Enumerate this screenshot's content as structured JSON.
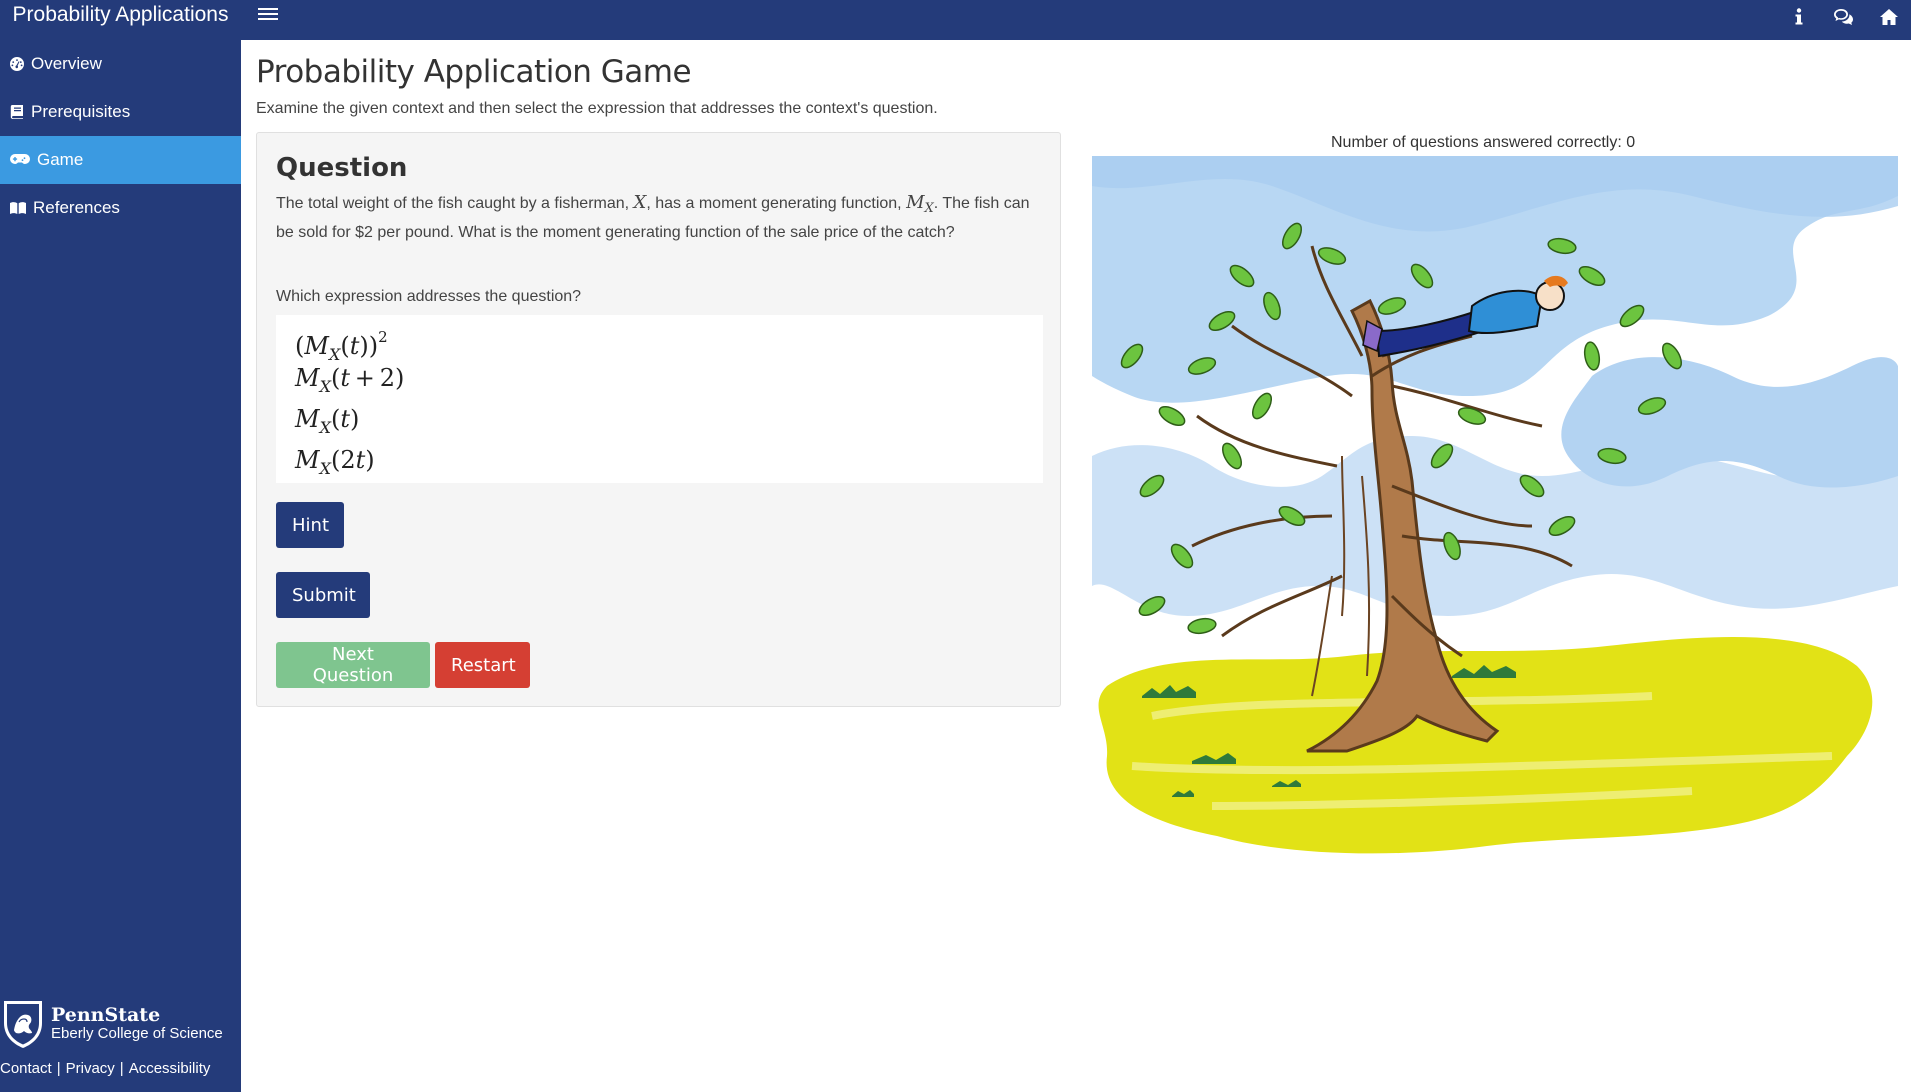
{
  "app": {
    "title": "Probability Applications",
    "menu_icon": "hamburger-icon",
    "header_icons": [
      "info-icon",
      "chat-bubbles-icon",
      "home-icon"
    ]
  },
  "sidebar": {
    "items": [
      {
        "label": "Overview",
        "icon": "dashboard-gauge-icon",
        "active": false
      },
      {
        "label": "Prerequisites",
        "icon": "book-icon",
        "active": false
      },
      {
        "label": "Game",
        "icon": "gamepad-icon",
        "active": true
      },
      {
        "label": "References",
        "icon": "open-book-icon",
        "active": false
      }
    ],
    "footer": {
      "university": "PennState",
      "college": "Eberly College of Science",
      "links": [
        "Contact",
        "Privacy",
        "Accessibility"
      ]
    }
  },
  "main": {
    "title": "Probability Application Game",
    "subtitle": "Examine the given context and then select the expression that addresses the context's question.",
    "score_label": "Number of questions answered correctly: 0",
    "question": {
      "heading": "Question",
      "text_parts": [
        "The total weight of the fish caught by a fisherman, ",
        "X",
        ", has a moment generating function, ",
        "M",
        "X",
        ". The fish can be sold for $2 per pound. What is the moment generating function of the sale price of the catch?"
      ],
      "prompt": "Which expression addresses the question?",
      "choices": [
        "(M_X(t))^2",
        "M_X(t+2)",
        "M_X(t)",
        "M_X(2t)"
      ]
    },
    "buttons": {
      "hint": "Hint",
      "submit": "Submit",
      "next": "Next Question",
      "restart": "Restart"
    },
    "illustration": "man-lying-in-tree-illustration"
  },
  "colors": {
    "header_bg": "#243b7a",
    "active_nav": "#3b9ae1",
    "primary_button": "#243b7a",
    "next_button": "#7fc58f",
    "restart_button": "#d53f33",
    "panel_bg": "#f5f5f5"
  }
}
